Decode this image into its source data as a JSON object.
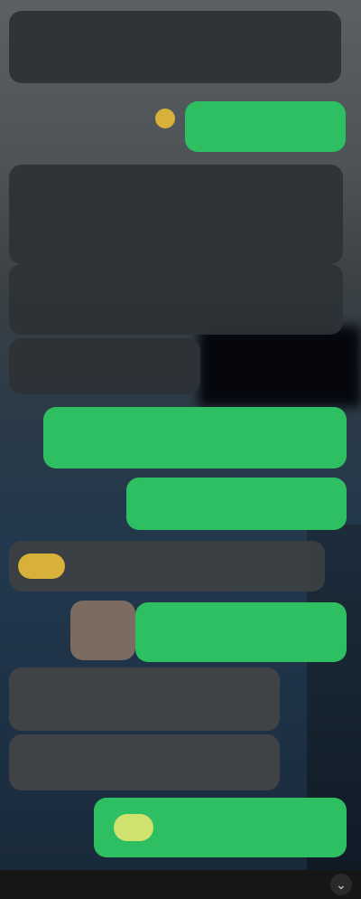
{
  "chat": {
    "messages": [
      {
        "id": "m1",
        "direction": "in",
        "text_1": "",
        "text_2": "",
        "time": ""
      },
      {
        "id": "m2",
        "direction": "out",
        "text_1": "",
        "text_2": "",
        "time": ""
      },
      {
        "id": "m3",
        "direction": "in",
        "text_1": "",
        "text_2": "",
        "time": ""
      },
      {
        "id": "m4",
        "direction": "in",
        "text_1": "",
        "text_2": "",
        "time": ""
      },
      {
        "id": "m5",
        "direction": "in",
        "text_1": "",
        "text_2": "",
        "time": ""
      },
      {
        "id": "m6",
        "direction": "out",
        "text_1": "",
        "text_2": "",
        "time": ""
      },
      {
        "id": "m7",
        "direction": "out",
        "text_1": "",
        "text_2": "",
        "time": ""
      },
      {
        "id": "m8",
        "direction": "in",
        "text_1": "",
        "text_2": "",
        "time": ""
      },
      {
        "id": "m9",
        "direction": "out",
        "text_1": "",
        "text_2": "",
        "time": ""
      },
      {
        "id": "m10",
        "direction": "in",
        "text_1": "",
        "text_2": "",
        "time": ""
      },
      {
        "id": "m11",
        "direction": "in",
        "text_1": "",
        "text_2": "",
        "time": ""
      },
      {
        "id": "m12",
        "direction": "out",
        "text_1": "",
        "text_2": "",
        "time": ""
      }
    ]
  },
  "colors": {
    "outgoing_bubble": "#2fbf63",
    "incoming_bubble": "#2d3236",
    "sticker": "#d8b13a"
  },
  "icons": {
    "scroll_down": "chevron-down-icon"
  }
}
